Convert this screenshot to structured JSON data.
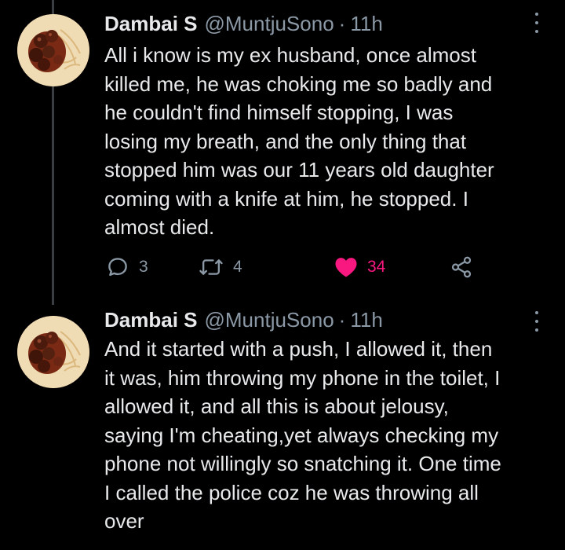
{
  "tweets": [
    {
      "name": "Dambai S",
      "handle": "@MuntjuSono",
      "separator": "·",
      "time": "11h",
      "text": "All i know is my ex husband, once almost\nkilled me, he was choking me so badly and\nhe couldn't find himself stopping, I was\nlosing my breath, and the only thing that\nstopped him was our 11 years old daughter\ncoming with a knife at him, he stopped. I\nalmost died.",
      "replies": "3",
      "retweets": "4",
      "likes": "34",
      "liked": true
    },
    {
      "name": "Dambai S",
      "handle": "@MuntjuSono",
      "separator": "·",
      "time": "11h",
      "text": "And it started with a push, I allowed it, then\nit was, him throwing my phone in the toilet, I\nallowed it, and all this is about jelousy,\nsaying I'm cheating,yet always checking my\nphone not willingly so snatching it. One time\nI called the police coz he was throwing all\nover"
    }
  ],
  "colors": {
    "background": "#000000",
    "text": "#e7e9ea",
    "secondary": "#8b98a5",
    "like": "#f91880",
    "thread_line": "#3a3e42"
  },
  "icons": {
    "reply": "speech-bubble-icon",
    "retweet": "retweet-arrows-icon",
    "like": "heart-filled-icon",
    "share": "share-nodes-icon",
    "more": "vertical-ellipsis-icon"
  }
}
